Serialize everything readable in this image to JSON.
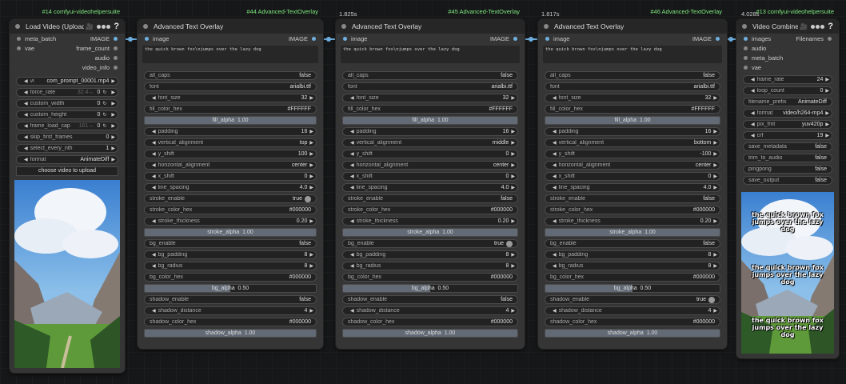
{
  "times": [
    "1.825s",
    "1.817s",
    "4.028s"
  ],
  "load": {
    "badge": "#14 comfyui-videohelpersuite",
    "title": "Load Video (Upload)",
    "cam": "🎥",
    "inputs": [
      "meta_batch",
      "vae"
    ],
    "outputs": [
      "IMAGE",
      "frame_count",
      "audio",
      "video_info"
    ],
    "widgets": [
      {
        "label": "vi",
        "value": "com_prompt_00001.mp4",
        "combo": true
      },
      {
        "label": "force_rate",
        "extra": "32.4↔",
        "value": "0",
        "num": true,
        "reset": true
      },
      {
        "label": "custom_width",
        "value": "0",
        "num": true,
        "reset": true
      },
      {
        "label": "custom_height",
        "value": "0",
        "num": true,
        "reset": true
      },
      {
        "label": "frame_load_cap",
        "extra": "161↔",
        "value": "0",
        "num": true,
        "reset": true
      },
      {
        "label": "skip_first_frames",
        "value": "0",
        "num": true
      },
      {
        "label": "select_every_nth",
        "value": "1",
        "num": true
      },
      {
        "label": "format",
        "value": "AnimateDiff",
        "combo": true
      }
    ],
    "button": "choose video to upload"
  },
  "overlays": [
    {
      "badge": "#44 Advanced-TextOverlay",
      "title": "Advanced Text Overlay",
      "input": "image",
      "output": "IMAGE",
      "text": "the quick brown fox\\njumps over the lazy dog",
      "rows": [
        {
          "t": "w",
          "label": "all_caps",
          "value": "false"
        },
        {
          "t": "w",
          "label": "font",
          "value": "arialbi.ttf"
        },
        {
          "t": "n",
          "label": "font_size",
          "value": "32"
        },
        {
          "t": "w",
          "label": "fill_color_hex",
          "value": "#FFFFFF"
        },
        {
          "t": "s",
          "label": "fill_alpha",
          "value": "1.00",
          "frac": 1
        },
        {
          "t": "n",
          "label": "padding",
          "value": "16"
        },
        {
          "t": "n",
          "label": "vertical_alignment",
          "value": "top"
        },
        {
          "t": "n",
          "label": "y_shift",
          "value": "100"
        },
        {
          "t": "n",
          "label": "horizontal_alignment",
          "value": "center"
        },
        {
          "t": "n",
          "label": "x_shift",
          "value": "0"
        },
        {
          "t": "n",
          "label": "line_spacing",
          "value": "4.0"
        },
        {
          "t": "b",
          "label": "stroke_enable",
          "value": "true",
          "on": true
        },
        {
          "t": "w",
          "label": "stroke_color_hex",
          "value": "#000000"
        },
        {
          "t": "n",
          "label": "stroke_thickness",
          "value": "0.20"
        },
        {
          "t": "s",
          "label": "stroke_alpha",
          "value": "1.00",
          "frac": 1
        },
        {
          "t": "w",
          "label": "bg_enable",
          "value": "false"
        },
        {
          "t": "n",
          "label": "bg_padding",
          "value": "8"
        },
        {
          "t": "n",
          "label": "bg_radius",
          "value": "8"
        },
        {
          "t": "w",
          "label": "bg_color_hex",
          "value": "#000000"
        },
        {
          "t": "s",
          "label": "bg_alpha",
          "value": "0.50",
          "frac": 0.5
        },
        {
          "t": "w",
          "label": "shadow_enable",
          "value": "false"
        },
        {
          "t": "n",
          "label": "shadow_distance",
          "value": "4"
        },
        {
          "t": "w",
          "label": "shadow_color_hex",
          "value": "#000000"
        },
        {
          "t": "s",
          "label": "shadow_alpha",
          "value": "1.00",
          "frac": 1
        }
      ]
    },
    {
      "badge": "#45 Advanced-TextOverlay",
      "title": "Advanced Text Overlay",
      "input": "image",
      "output": "IMAGE",
      "text": "the quick brown fox\\njumps over the lazy dog",
      "rows": [
        {
          "t": "w",
          "label": "all_caps",
          "value": "false"
        },
        {
          "t": "w",
          "label": "font",
          "value": "arialbi.ttf"
        },
        {
          "t": "n",
          "label": "font_size",
          "value": "32"
        },
        {
          "t": "w",
          "label": "fill_color_hex",
          "value": "#FFFFFF"
        },
        {
          "t": "s",
          "label": "fill_alpha",
          "value": "1.00",
          "frac": 1
        },
        {
          "t": "n",
          "label": "padding",
          "value": "16"
        },
        {
          "t": "n",
          "label": "vertical_alignment",
          "value": "middle"
        },
        {
          "t": "n",
          "label": "y_shift",
          "value": "0"
        },
        {
          "t": "n",
          "label": "horizontal_alignment",
          "value": "center"
        },
        {
          "t": "n",
          "label": "x_shift",
          "value": "0"
        },
        {
          "t": "n",
          "label": "line_spacing",
          "value": "4.0"
        },
        {
          "t": "w",
          "label": "stroke_enable",
          "value": "false"
        },
        {
          "t": "w",
          "label": "stroke_color_hex",
          "value": "#000000"
        },
        {
          "t": "n",
          "label": "stroke_thickness",
          "value": "0.20"
        },
        {
          "t": "s",
          "label": "stroke_alpha",
          "value": "1.00",
          "frac": 1
        },
        {
          "t": "b",
          "label": "bg_enable",
          "value": "true",
          "on": true
        },
        {
          "t": "n",
          "label": "bg_padding",
          "value": "8"
        },
        {
          "t": "n",
          "label": "bg_radius",
          "value": "8"
        },
        {
          "t": "w",
          "label": "bg_color_hex",
          "value": "#000000"
        },
        {
          "t": "s",
          "label": "bg_alpha",
          "value": "0.50",
          "frac": 0.5
        },
        {
          "t": "w",
          "label": "shadow_enable",
          "value": "false"
        },
        {
          "t": "n",
          "label": "shadow_distance",
          "value": "4"
        },
        {
          "t": "w",
          "label": "shadow_color_hex",
          "value": "#000000"
        },
        {
          "t": "s",
          "label": "shadow_alpha",
          "value": "1.00",
          "frac": 1
        }
      ]
    },
    {
      "badge": "#46 Advanced-TextOverlay",
      "title": "Advanced Text Overlay",
      "input": "image",
      "output": "IMAGE",
      "text": "the quick brown fox\\njumps over the lazy dog",
      "rows": [
        {
          "t": "w",
          "label": "all_caps",
          "value": "false"
        },
        {
          "t": "w",
          "label": "font",
          "value": "arialbi.ttf"
        },
        {
          "t": "n",
          "label": "font_size",
          "value": "32"
        },
        {
          "t": "w",
          "label": "fill_color_hex",
          "value": "#FFFFFF"
        },
        {
          "t": "s",
          "label": "fill_alpha",
          "value": "1.00",
          "frac": 1
        },
        {
          "t": "n",
          "label": "padding",
          "value": "16"
        },
        {
          "t": "n",
          "label": "vertical_alignment",
          "value": "bottom"
        },
        {
          "t": "n",
          "label": "y_shift",
          "value": "-100"
        },
        {
          "t": "n",
          "label": "horizontal_alignment",
          "value": "center"
        },
        {
          "t": "n",
          "label": "x_shift",
          "value": "0"
        },
        {
          "t": "n",
          "label": "line_spacing",
          "value": "4.0"
        },
        {
          "t": "w",
          "label": "stroke_enable",
          "value": "false"
        },
        {
          "t": "w",
          "label": "stroke_color_hex",
          "value": "#000000"
        },
        {
          "t": "n",
          "label": "stroke_thickness",
          "value": "0.20"
        },
        {
          "t": "s",
          "label": "stroke_alpha",
          "value": "1.00",
          "frac": 1
        },
        {
          "t": "w",
          "label": "bg_enable",
          "value": "false"
        },
        {
          "t": "n",
          "label": "bg_padding",
          "value": "8"
        },
        {
          "t": "n",
          "label": "bg_radius",
          "value": "8"
        },
        {
          "t": "w",
          "label": "bg_color_hex",
          "value": "#000000"
        },
        {
          "t": "s",
          "label": "bg_alpha",
          "value": "0.50",
          "frac": 0.5
        },
        {
          "t": "b",
          "label": "shadow_enable",
          "value": "true",
          "on": true
        },
        {
          "t": "n",
          "label": "shadow_distance",
          "value": "4"
        },
        {
          "t": "w",
          "label": "shadow_color_hex",
          "value": "#000000"
        },
        {
          "t": "s",
          "label": "shadow_alpha",
          "value": "1.00",
          "frac": 1
        }
      ]
    }
  ],
  "combine": {
    "badge": "#13 comfyui-videohelpersuite",
    "title": "Video Combine",
    "cam": "🎥",
    "inputs": [
      "images",
      "audio",
      "meta_batch",
      "vae"
    ],
    "output": "Filenames",
    "widgets": [
      {
        "t": "n",
        "label": "frame_rate",
        "value": "24"
      },
      {
        "t": "n",
        "label": "loop_count",
        "value": "0"
      },
      {
        "t": "w",
        "label": "filename_prefix",
        "value": "AnimateDiff"
      },
      {
        "t": "n",
        "label": "format",
        "value": "video/h264-mp4"
      },
      {
        "t": "n",
        "label": "pix_fmt",
        "value": "yuv420p"
      },
      {
        "t": "n",
        "label": "crf",
        "value": "19"
      },
      {
        "t": "w",
        "label": "save_metadata",
        "value": "false"
      },
      {
        "t": "w",
        "label": "trim_to_audio",
        "value": "false"
      },
      {
        "t": "w",
        "label": "pingpong",
        "value": "false"
      },
      {
        "t": "w",
        "label": "save_output",
        "value": "false"
      }
    ],
    "overlay_texts": [
      "the quick brown fox jumps over the lazy dog",
      "the quick brown fox jumps over the lazy dog",
      "the quick brown fox jumps over the lazy dog"
    ]
  },
  "colors": {
    "wire": "#6fb0e0",
    "badge_green": "#7ee87e",
    "slider_fill": "#626a76"
  }
}
